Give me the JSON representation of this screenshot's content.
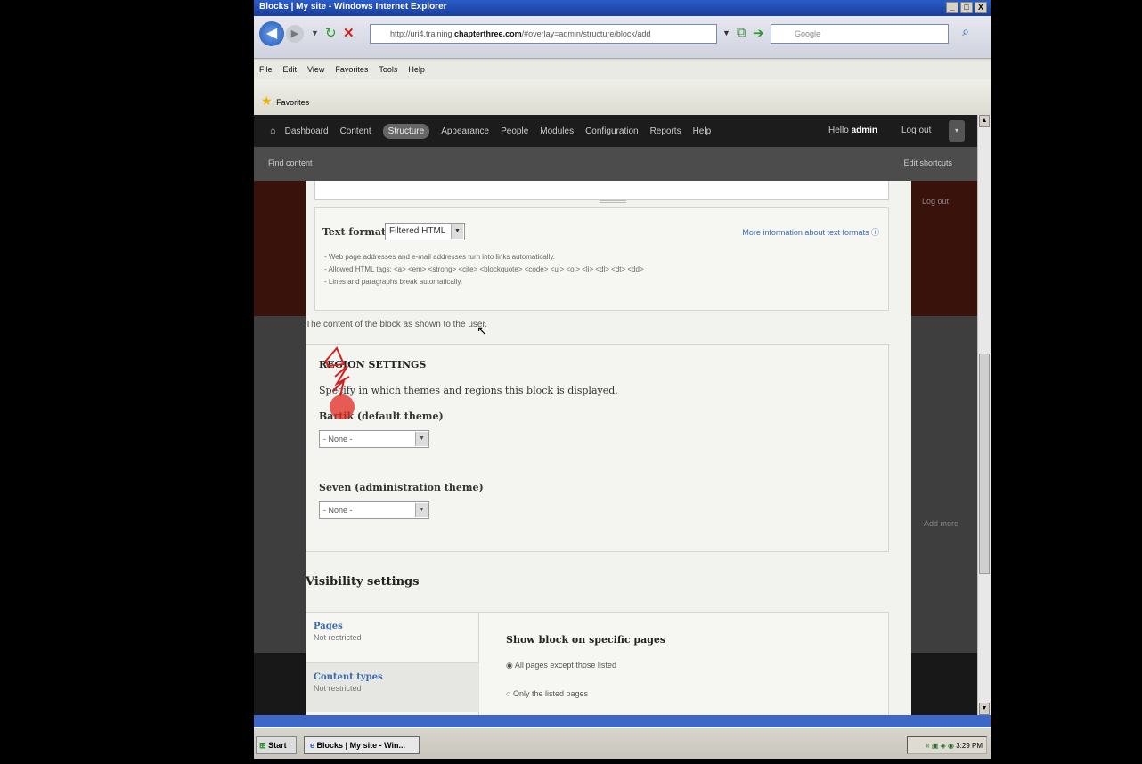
{
  "window": {
    "title": "Blocks | My site - Windows Internet Explorer",
    "controls": [
      "_",
      "□",
      "X"
    ]
  },
  "browser": {
    "address_prefix": "http://uri4.training.",
    "address_domain": "chapterthree.com",
    "address_path": "/#overlay=admin/structure/block/add",
    "search_placeholder": "Google",
    "menu": [
      "File",
      "Edit",
      "View",
      "Favorites",
      "Tools",
      "Help"
    ],
    "favorites_label": "Favorites"
  },
  "toolbar": {
    "items": [
      "Dashboard",
      "Content",
      "Structure",
      "Appearance",
      "People",
      "Modules",
      "Configuration",
      "Reports",
      "Help"
    ],
    "active": "Structure",
    "hello_prefix": "Hello ",
    "user": "admin",
    "logout": "Log out",
    "find_content": "Find content",
    "edit_shortcuts": "Edit shortcuts"
  },
  "background": {
    "ghost_logout": "Log out",
    "ghost_add_more": "Add more"
  },
  "form": {
    "text_format_label": "Text format",
    "text_format_value": "Filtered HTML",
    "more_info": "More information about text formats",
    "tips": [
      "Web page addresses and e-mail addresses turn into links automatically.",
      "Allowed HTML tags: <a> <em> <strong> <cite> <blockquote> <code> <ul> <ol> <li> <dl> <dt> <dd>",
      "Lines and paragraphs break automatically."
    ],
    "block_description": "The content of the block as shown to the user.",
    "region": {
      "title": "REGION SETTINGS",
      "description": "Specify in which themes and regions this block is displayed.",
      "themes": [
        {
          "label": "Bartik (default theme)",
          "value": "- None -"
        },
        {
          "label": "Seven (administration theme)",
          "value": "- None -"
        }
      ]
    },
    "visibility": {
      "title": "Visibility settings",
      "tabs": [
        {
          "title": "Pages",
          "summary": "Not restricted"
        },
        {
          "title": "Content types",
          "summary": "Not restricted"
        }
      ],
      "show_title": "Show block on specific pages",
      "options": [
        {
          "label": "All pages except those listed",
          "selected": true
        },
        {
          "label": "Only the listed pages",
          "selected": false
        }
      ]
    }
  },
  "taskbar": {
    "start": "Start",
    "task": "Blocks | My site - Win...",
    "clock": "3:29 PM"
  }
}
